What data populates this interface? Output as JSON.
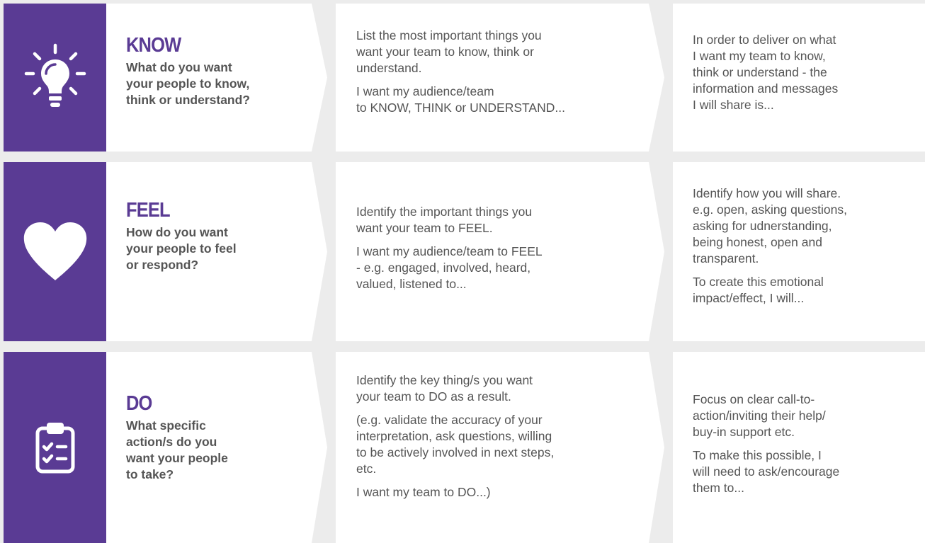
{
  "colors": {
    "purple": "#5a3b94",
    "text": "#555555",
    "background": "#ececec"
  },
  "rows": [
    {
      "icon": "lightbulb-icon",
      "heading": "KNOW",
      "question": "What do you want\nyour people to know,\nthink or understand?",
      "col2": [
        "List the most important things you\nwant your team to know, think or\nunderstand.",
        "I want my audience/team\nto KNOW, THINK or UNDERSTAND..."
      ],
      "col3": [
        "In order to deliver on what\nI want my team to know,\nthink or understand - the\ninformation and messages\nI will share is..."
      ]
    },
    {
      "icon": "heart-icon",
      "heading": "FEEL",
      "question": "How do you want\nyour people to feel\nor respond?",
      "col2": [
        "Identify the important things you\nwant your team to FEEL.",
        "I want my audience/team to FEEL\n- e.g. engaged, involved, heard,\nvalued, listened to..."
      ],
      "col3": [
        "Identify how you will share.\ne.g. open, asking questions,\nasking for udnerstanding,\nbeing honest, open and\ntransparent.",
        "To create this emotional\nimpact/effect, I will..."
      ]
    },
    {
      "icon": "clipboard-checklist-icon",
      "heading": "DO",
      "question": "What specific\naction/s do you\nwant your people\nto take?",
      "col2": [
        "Identify the key thing/s you want\nyour team to DO as a result.",
        "(e.g. validate the accuracy of your\ninterpretation, ask questions, willing\nto be actively involved in next steps,\netc.",
        "I want my team to DO...)"
      ],
      "col3": [
        "Focus on clear call-to-\naction/inviting their help/\nbuy-in support etc.",
        "To make this possible, I\nwill need to ask/encourage\nthem to..."
      ]
    }
  ]
}
